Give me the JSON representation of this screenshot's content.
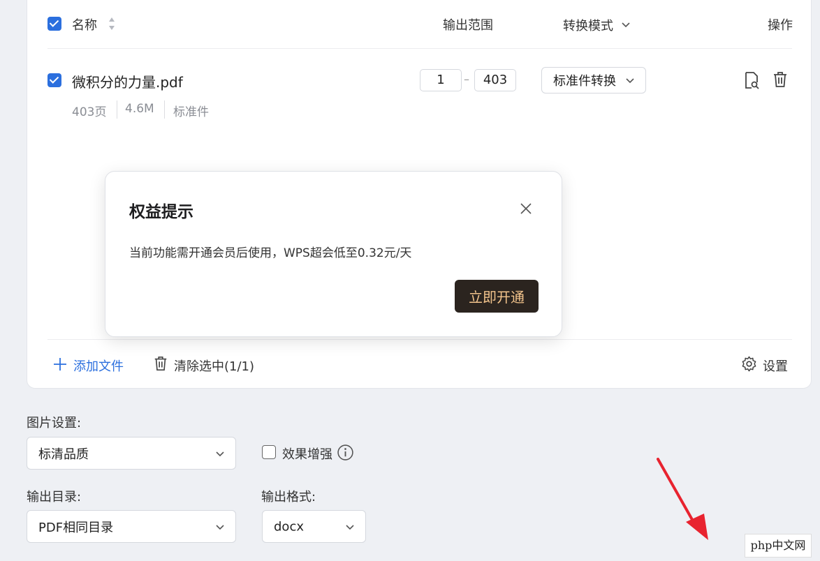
{
  "table": {
    "header": {
      "name": "名称",
      "range": "输出范围",
      "mode": "转换模式",
      "actions": "操作"
    },
    "file": {
      "name": "微积分的力量.pdf",
      "range_start": "1",
      "range_end": "403",
      "range_dash": "–",
      "mode": "标准件转换",
      "pages": "403页",
      "size": "4.6M",
      "type": "标准件"
    },
    "footer": {
      "add_file": "添加文件",
      "clear_selected": "清除选中(1/1)",
      "settings": "设置"
    }
  },
  "modal": {
    "title": "权益提示",
    "message": "当前功能需开通会员后使用，WPS超会低至0.32元/天",
    "cta": "立即开通"
  },
  "options": {
    "image_settings_label": "图片设置:",
    "image_quality": "标清品质",
    "enhance_label": "效果增强",
    "output_dir_label": "输出目录:",
    "output_dir": "PDF相同目录",
    "output_format_label": "输出格式:",
    "output_format": "docx"
  },
  "watermark": "php中文网",
  "colors": {
    "accent": "#2b6fde",
    "cta_bg": "#2b241f",
    "cta_text": "#f3c48c",
    "arrow": "#e8232f"
  }
}
